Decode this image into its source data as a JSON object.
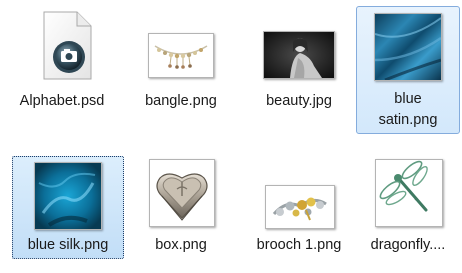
{
  "files": [
    {
      "name": "Alphabet.psd",
      "icon": "psd-document-icon"
    },
    {
      "name": "bangle.png",
      "icon": "bangle-thumbnail"
    },
    {
      "name": "beauty.jpg",
      "icon": "beauty-thumbnail"
    },
    {
      "name": "blue\nsatin.png",
      "icon": "blue-satin-thumbnail",
      "selected": true
    },
    {
      "name": "blue silk.png",
      "icon": "blue-silk-thumbnail",
      "selected": true,
      "focused": true
    },
    {
      "name": "box.png",
      "icon": "box-thumbnail"
    },
    {
      "name": "brooch 1.png",
      "icon": "brooch-thumbnail"
    },
    {
      "name": "dragonfly....",
      "icon": "dragonfly-thumbnail"
    }
  ],
  "colors": {
    "selection_bg": "#d3e8fb",
    "selection_border": "#84acdd",
    "focus_border": "#1f3d66"
  }
}
